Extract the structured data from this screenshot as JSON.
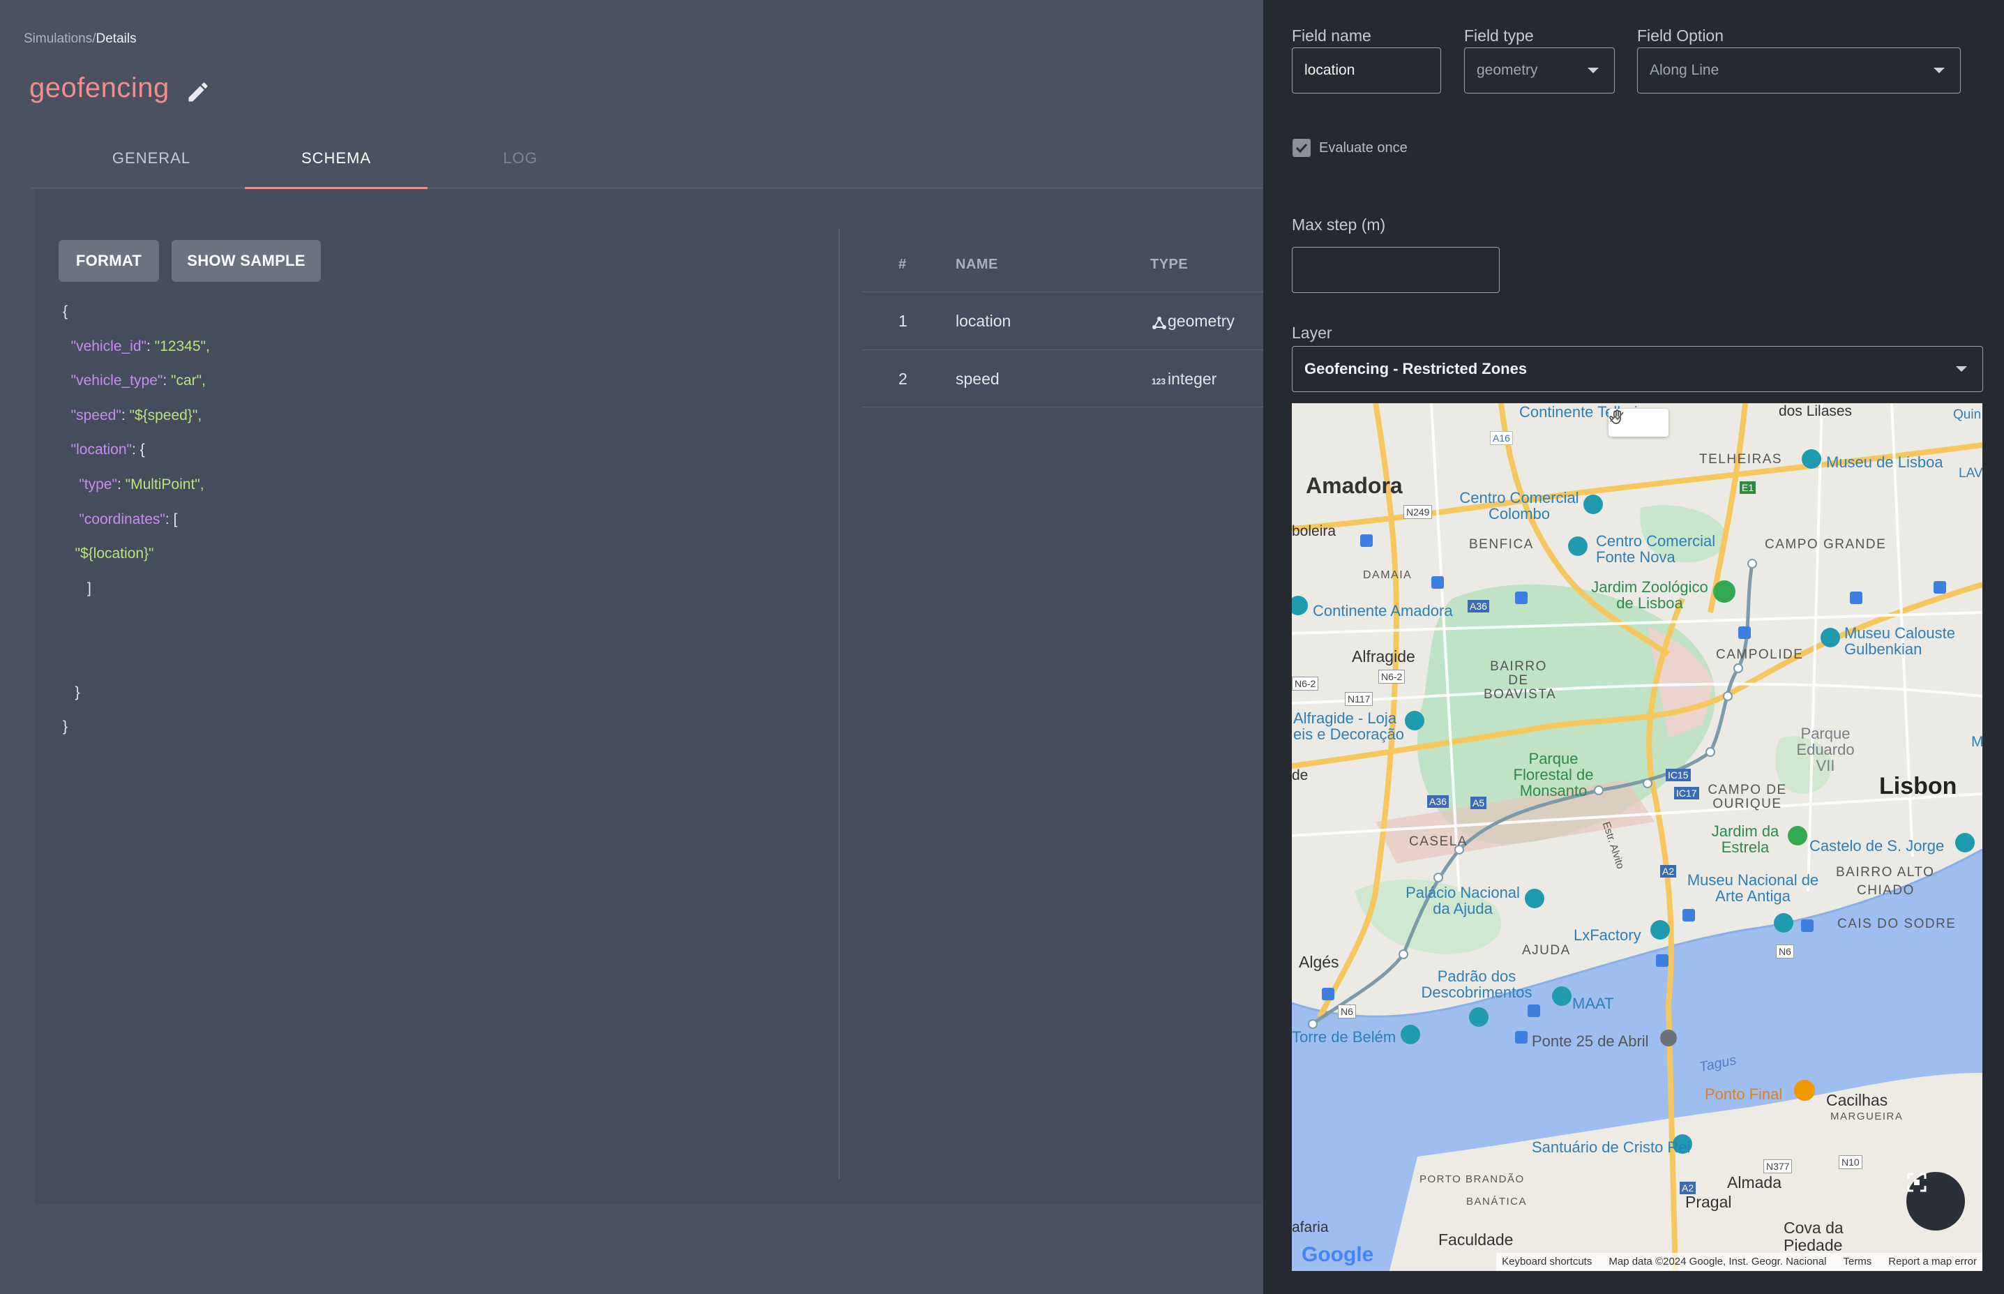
{
  "breadcrumb": {
    "parent": "Simulations/",
    "current": "Details"
  },
  "page": {
    "title": "geofencing"
  },
  "tabs": [
    {
      "label": "GENERAL"
    },
    {
      "label": "SCHEMA"
    },
    {
      "label": "LOG"
    }
  ],
  "toolbar": {
    "format_label": "FORMAT",
    "show_sample_label": "SHOW SAMPLE"
  },
  "code": {
    "l1": "{",
    "vehicle_id_key": "\"vehicle_id\"",
    "vehicle_id_val": "\"12345\",",
    "vehicle_type_key": "\"vehicle_type\"",
    "vehicle_type_val": "\"car\",",
    "speed_key": "\"speed\"",
    "speed_val": "\"${speed}\",",
    "location_key": "\"location\"",
    "location_open": ": {",
    "type_key": "\"type\"",
    "type_val": "\"MultiPoint\",",
    "coordinates_key": "\"coordinates\"",
    "coordinates_open": ": [",
    "location_placeholder": "\"${location}\"",
    "close_bracket": "]",
    "close_inner": "}",
    "close_outer": "}"
  },
  "fields_table": {
    "headers": {
      "num": "#",
      "name": "NAME",
      "type": "TYPE"
    },
    "rows": [
      {
        "num": "1",
        "name": "location",
        "type": "geometry",
        "icon": "geometry-icon"
      },
      {
        "num": "2",
        "name": "speed",
        "type": "integer",
        "icon": "integer-icon"
      }
    ]
  },
  "side_panel": {
    "field_name_label": "Field name",
    "field_name_value": "location",
    "field_type_label": "Field type",
    "field_type_value": "geometry",
    "field_option_label": "Field Option",
    "field_option_value": "Along Line",
    "evaluate_once_label": "Evaluate once",
    "max_step_label": "Max step (m)",
    "max_step_value": "",
    "layer_label": "Layer",
    "layer_value": "Geofencing - Restricted Zones"
  },
  "map": {
    "labels": {
      "amadora": "Amadora",
      "lisbon": "Lisbon",
      "telheiras": "TELHEIRAS",
      "benfica": "BENFICA",
      "campo_grande": "CAMPO GRANDE",
      "damaia": "DAMAIA",
      "alfragide": "Alfragide",
      "bairro_boavista": "BAIRRO DE BOAVISTA",
      "campolide": "CAMPOLIDE",
      "parque_florestal": "Parque Florestal de Monsanto",
      "campo_ourique": "CAMPO DE OURIQUE",
      "casela": "CASELA",
      "ajuda": "AJUDA",
      "alges": "Algés",
      "bairro_alto": "BAIRRO ALTO",
      "chiado": "CHIADO",
      "cais_sodre": "CAIS DO SODRE",
      "cacilhas": "Cacilhas",
      "margueira": "MARGUEIRA",
      "almada": "Almada",
      "pragal": "Pragal",
      "cova_piedade": "Cova da Piedade",
      "porto_brandao": "PORTO BRANDÃO",
      "banatica": "BANÁTICA",
      "faculdade": "Faculdade",
      "tagus": "Tagus",
      "centro_colombo": "Centro Comercial Colombo",
      "centro_fonte_nova": "Centro Comercial Fonte Nova",
      "zoo": "Jardim Zoológico de Lisboa",
      "continente_amadora": "Continente Amadora",
      "alfragide_loja": "Alfragide - Loja eis e Decoração",
      "museu_gulbenkian": "Museu Calouste Gulbenkian",
      "parque_eduardo": "Parque Eduardo VII",
      "jardim_estrela": "Jardim da Estrela",
      "castelo": "Castelo de S. Jorge",
      "museu_arte_antiga": "Museu Nacional de Arte Antiga",
      "palacio_ajuda": "Palácio Nacional da Ajuda",
      "lxfactory": "LxFactory",
      "padrao": "Padrão dos Descobrimentos",
      "maat": "MAAT",
      "torre_belem": "Torre de Belém",
      "ponte": "Ponte 25 de Abril",
      "ponto_final": "Ponto Final",
      "cristo_rei": "Santuário de Cristo Rei",
      "museu_lisboa": "Museu de Lisboa",
      "dos_lilases": "dos Lilases",
      "continente_telheiras": "Continente Telheiras",
      "boleira": "boleira",
      "de": "de",
      "afaria": "afaria",
      "lav": "LAV",
      "quin": "Quin",
      "m": "M",
      "estr_alvito": "Estr. Alvito"
    },
    "roads": {
      "a16": "A16",
      "n249": "N249",
      "e1": "E1",
      "a36": "A36",
      "n6_2a": "N6-2",
      "n6_2b": "N6-2",
      "n117": "N117",
      "a5": "A5",
      "ic17": "IC17",
      "a2": "A2",
      "n6": "N6",
      "n6b": "N6",
      "n377": "N377",
      "n10": "N10",
      "a2b": "A2",
      "ic15": "IC15",
      "a36b": "A36"
    },
    "attribution": {
      "shortcuts": "Keyboard shortcuts",
      "data": "Map data ©2024 Google, Inst. Geogr. Nacional",
      "terms": "Terms",
      "report": "Report a map error"
    },
    "logo": "Google"
  }
}
